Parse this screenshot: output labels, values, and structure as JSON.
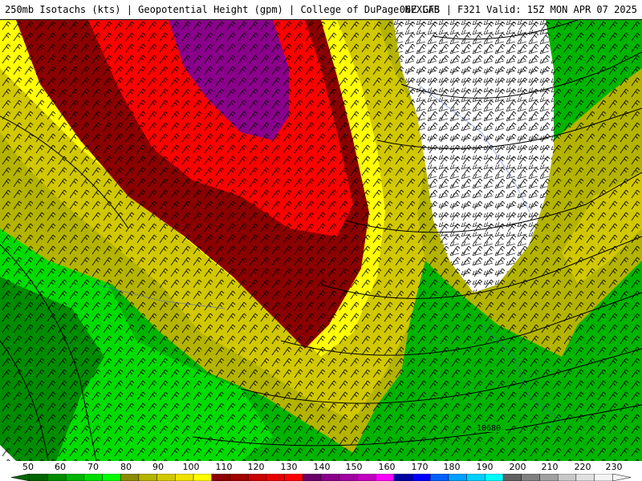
{
  "header": {
    "title_left": "250mb Isotachs (kts) | Geopotential Height (gpm) | College of DuPage NEXLAB",
    "title_right": "06Z GFS | F321 Valid: 15Z MON APR 07 2025"
  },
  "map": {
    "contour_label": "10680",
    "field": "250mb wind speed (kts) with wind barbs and geopotential height contours"
  },
  "legend": {
    "labels": [
      "50",
      "60",
      "70",
      "80",
      "90",
      "100",
      "110",
      "120",
      "130",
      "140",
      "150",
      "160",
      "170",
      "180",
      "190",
      "200",
      "210",
      "220",
      "230"
    ],
    "colors": [
      "#006400",
      "#008c00",
      "#00b400",
      "#00dc00",
      "#00ff00",
      "#8b8b00",
      "#b4b400",
      "#d2c800",
      "#f0e100",
      "#ffff00",
      "#8b0000",
      "#a00000",
      "#c80000",
      "#e60000",
      "#ff0000",
      "#6a006a",
      "#8b008b",
      "#a000a0",
      "#c000c0",
      "#ff00ff",
      "#0000a0",
      "#0000ff",
      "#0060ff",
      "#00a0ff",
      "#00d0ff",
      "#00ffff",
      "#606060",
      "#808080",
      "#a0a0a0",
      "#c8c8c8",
      "#e0e0e0",
      "#f4f4f4"
    ]
  }
}
